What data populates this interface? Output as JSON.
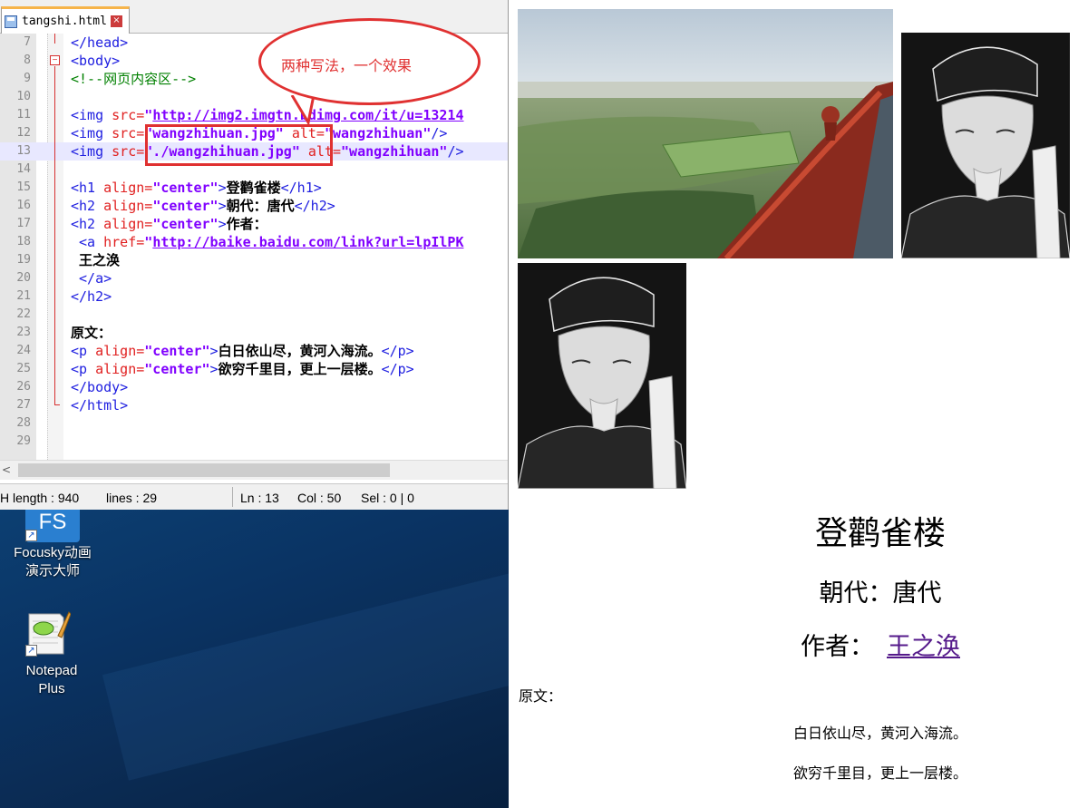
{
  "editor": {
    "tab": {
      "filename": "tangshi.html",
      "close": "×"
    },
    "lines": [
      {
        "n": "7",
        "parts": [
          [
            "t",
            "</head>"
          ]
        ]
      },
      {
        "n": "8",
        "parts": [
          [
            "t",
            "<body>"
          ]
        ]
      },
      {
        "n": "9",
        "parts": [
          [
            "c",
            "<!--网页内容区-->"
          ]
        ]
      },
      {
        "n": "10",
        "parts": []
      },
      {
        "n": "11",
        "parts": [
          [
            "t",
            "<img "
          ],
          [
            "a",
            "src="
          ],
          [
            "s",
            "\""
          ],
          [
            "su",
            "http://img2.imgtn.bdimg.com/it/u=13214"
          ]
        ]
      },
      {
        "n": "12",
        "parts": [
          [
            "t",
            "<img "
          ],
          [
            "a",
            "src="
          ],
          [
            "s",
            "\"wangzhihuan.jpg\""
          ],
          [
            "t",
            " "
          ],
          [
            "a",
            "alt="
          ],
          [
            "s",
            "\"wangzhihuan\""
          ],
          [
            "t",
            "/>"
          ]
        ]
      },
      {
        "n": "13",
        "parts": [
          [
            "t",
            "<img "
          ],
          [
            "a",
            "src="
          ],
          [
            "s",
            "\"./wangzhihuan.jpg\""
          ],
          [
            "t",
            " "
          ],
          [
            "a",
            "alt="
          ],
          [
            "s",
            "\"wangzhihuan\""
          ],
          [
            "t",
            "/>"
          ]
        ]
      },
      {
        "n": "14",
        "parts": []
      },
      {
        "n": "15",
        "parts": [
          [
            "t",
            "<h1 "
          ],
          [
            "a",
            "align="
          ],
          [
            "s",
            "\"center\""
          ],
          [
            "t",
            ">"
          ],
          [
            "b",
            "登鹳雀楼"
          ],
          [
            "t",
            "</h1>"
          ]
        ]
      },
      {
        "n": "16",
        "parts": [
          [
            "t",
            "<h2 "
          ],
          [
            "a",
            "align="
          ],
          [
            "s",
            "\"center\""
          ],
          [
            "t",
            ">"
          ],
          [
            "b",
            "朝代：唐代"
          ],
          [
            "t",
            "</h2>"
          ]
        ]
      },
      {
        "n": "17",
        "parts": [
          [
            "t",
            "<h2 "
          ],
          [
            "a",
            "align="
          ],
          [
            "s",
            "\"center\""
          ],
          [
            "t",
            ">"
          ],
          [
            "b",
            "作者："
          ]
        ]
      },
      {
        "n": "18",
        "parts": [
          [
            "t",
            " <a "
          ],
          [
            "a",
            "href="
          ],
          [
            "s",
            "\""
          ],
          [
            "su",
            "http://baike.baidu.com/link?url=lpIlPK"
          ]
        ]
      },
      {
        "n": "19",
        "parts": [
          [
            "b",
            " 王之涣"
          ]
        ]
      },
      {
        "n": "20",
        "parts": [
          [
            "t",
            " </a>"
          ]
        ]
      },
      {
        "n": "21",
        "parts": [
          [
            "t",
            "</h2>"
          ]
        ]
      },
      {
        "n": "22",
        "parts": []
      },
      {
        "n": "23",
        "parts": [
          [
            "b",
            "原文："
          ]
        ]
      },
      {
        "n": "24",
        "parts": [
          [
            "t",
            "<p "
          ],
          [
            "a",
            "align="
          ],
          [
            "s",
            "\"center\""
          ],
          [
            "t",
            ">"
          ],
          [
            "b",
            "白日依山尽，黄河入海流。"
          ],
          [
            "t",
            "</p>"
          ]
        ]
      },
      {
        "n": "25",
        "parts": [
          [
            "t",
            "<p "
          ],
          [
            "a",
            "align="
          ],
          [
            "s",
            "\"center\""
          ],
          [
            "t",
            ">"
          ],
          [
            "b",
            "欲穷千里目，更上一层楼。"
          ],
          [
            "t",
            "</p>"
          ]
        ]
      },
      {
        "n": "26",
        "parts": [
          [
            "t",
            "</body>"
          ]
        ]
      },
      {
        "n": "27",
        "parts": [
          [
            "t",
            "</html>"
          ]
        ]
      },
      {
        "n": "28",
        "parts": []
      },
      {
        "n": "29",
        "parts": []
      }
    ],
    "current_line": "13",
    "callout_text": "两种写法，一个效果"
  },
  "statusbar": {
    "length": "H length : 940",
    "lines": "lines : 29",
    "ln": "Ln : 13",
    "col": "Col : 50",
    "sel": "Sel : 0 | 0"
  },
  "desktop": {
    "icons": [
      {
        "label1": "Focusky动画",
        "label2": "演示大师",
        "glyph": "FS"
      },
      {
        "label1": "Notepad",
        "label2": "Plus",
        "glyph": ""
      }
    ]
  },
  "page": {
    "images": {
      "img1_alt": "",
      "img2_alt": "wangzhihuan",
      "img3_alt": "wangzhihuan"
    },
    "h1": "登鹳雀楼",
    "dynasty": "朝代：唐代",
    "author_label": "作者：",
    "author_link": "王之涣",
    "yuanwen": "原文：",
    "p1": "白日依山尽，黄河入海流。",
    "p2": "欲穷千里目，更上一层楼。"
  },
  "colors": {
    "tag": "#2020e0",
    "attr": "#e02020",
    "string": "#8000ff",
    "comment": "#008000",
    "annotation": "#e03131",
    "link_visited": "#551a8b"
  },
  "icons": [
    "save-icon",
    "close-icon",
    "fold-minus-icon",
    "scroll-left-icon",
    "focusky-app-icon",
    "notepad-plus-app-icon",
    "shortcut-arrow-icon"
  ]
}
